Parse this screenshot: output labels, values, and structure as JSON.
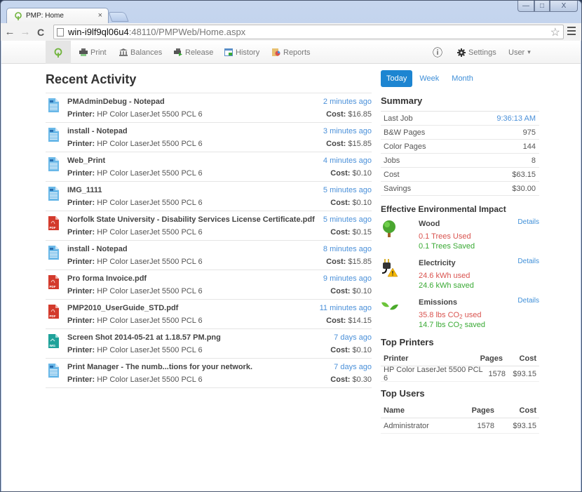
{
  "browser": {
    "tab_title": "PMP: Home",
    "tab_close": "×",
    "url_host": "win-i9lf9ql06u4",
    "url_path": ":48110/PMPWeb/Home.aspx",
    "back": "←",
    "forward": "→",
    "reload": "C",
    "star": "☆",
    "win_min": "—",
    "win_max": "□",
    "win_close": "X"
  },
  "nav": {
    "items": [
      {
        "label": "Print",
        "icon": "printer-icon"
      },
      {
        "label": "Balances",
        "icon": "bank-icon"
      },
      {
        "label": "Release",
        "icon": "release-printer-icon"
      },
      {
        "label": "History",
        "icon": "history-icon"
      },
      {
        "label": "Reports",
        "icon": "reports-icon"
      }
    ],
    "info": "ⓘ",
    "settings": "Settings",
    "user": "User",
    "user_caret": "▾"
  },
  "recent": {
    "title": "Recent Activity",
    "printer_label": "Printer:",
    "cost_label": "Cost:",
    "items": [
      {
        "name": "PMAdminDebug - Notepad",
        "type": "doc",
        "printer": "HP Color LaserJet 5500 PCL 6",
        "time": "2 minutes ago",
        "cost": "$16.85"
      },
      {
        "name": "install - Notepad",
        "type": "doc",
        "printer": "HP Color LaserJet 5500 PCL 6",
        "time": "3 minutes ago",
        "cost": "$15.85"
      },
      {
        "name": "Web_Print",
        "type": "doc",
        "printer": "HP Color LaserJet 5500 PCL 6",
        "time": "4 minutes ago",
        "cost": "$0.10"
      },
      {
        "name": "IMG_1111",
        "type": "doc",
        "printer": "HP Color LaserJet 5500 PCL 6",
        "time": "5 minutes ago",
        "cost": "$0.10"
      },
      {
        "name": "Norfolk State University - Disability Services License Certificate.pdf",
        "type": "pdf",
        "printer": "HP Color LaserJet 5500 PCL 6",
        "time": "5 minutes ago",
        "cost": "$0.15"
      },
      {
        "name": "install - Notepad",
        "type": "doc",
        "printer": "HP Color LaserJet 5500 PCL 6",
        "time": "8 minutes ago",
        "cost": "$15.85"
      },
      {
        "name": "Pro forma Invoice.pdf",
        "type": "pdf",
        "printer": "HP Color LaserJet 5500 PCL 6",
        "time": "9 minutes ago",
        "cost": "$0.10"
      },
      {
        "name": "PMP2010_UserGuide_STD.pdf",
        "type": "pdf",
        "printer": "HP Color LaserJet 5500 PCL 6",
        "time": "11 minutes ago",
        "cost": "$14.15"
      },
      {
        "name": "Screen Shot 2014-05-21 at 1.18.57 PM.png",
        "type": "img",
        "printer": "HP Color LaserJet 5500 PCL 6",
        "time": "7 days ago",
        "cost": "$0.10"
      },
      {
        "name": "Print Manager - The numb...tions for your network.",
        "type": "doc",
        "printer": "HP Color LaserJet 5500 PCL 6",
        "time": "7 days ago",
        "cost": "$0.30"
      }
    ]
  },
  "periods": {
    "items": [
      "Today",
      "Week",
      "Month"
    ],
    "active": "Today"
  },
  "summary": {
    "title": "Summary",
    "rows": [
      {
        "label": "Last Job",
        "value": "9:36:13 AM"
      },
      {
        "label": "B&W Pages",
        "value": "975"
      },
      {
        "label": "Color Pages",
        "value": "144"
      },
      {
        "label": "Jobs",
        "value": "8"
      },
      {
        "label": "Cost",
        "value": "$63.15"
      },
      {
        "label": "Savings",
        "value": "$30.00"
      }
    ]
  },
  "environment": {
    "title": "Effective Environmental Impact",
    "details_label": "Details",
    "wood": {
      "title": "Wood",
      "used": "0.1 Trees Used",
      "saved": "0.1 Trees Saved"
    },
    "electricity": {
      "title": "Electricity",
      "used": "24.6 kWh used",
      "saved": "24.6 kWh saved"
    },
    "emissions": {
      "title": "Emissions",
      "used_pre": "35.8 lbs CO",
      "used_post": " used",
      "saved_pre": "14.7 lbs CO",
      "saved_post": " saved",
      "sub": "2"
    },
    "colors": {
      "used": "#d9534f",
      "saved": "#3aaa35"
    }
  },
  "top_printers": {
    "title": "Top Printers",
    "headers": [
      "Printer",
      "Pages",
      "Cost"
    ],
    "rows": [
      [
        "HP Color LaserJet 5500 PCL 6",
        "1578",
        "$93.15"
      ]
    ]
  },
  "top_users": {
    "title": "Top Users",
    "headers": [
      "Name",
      "Pages",
      "Cost"
    ],
    "rows": [
      [
        "Administrator",
        "1578",
        "$93.15"
      ]
    ]
  },
  "colors": {
    "accent": "#1d85d1",
    "link": "#4a90d9"
  }
}
